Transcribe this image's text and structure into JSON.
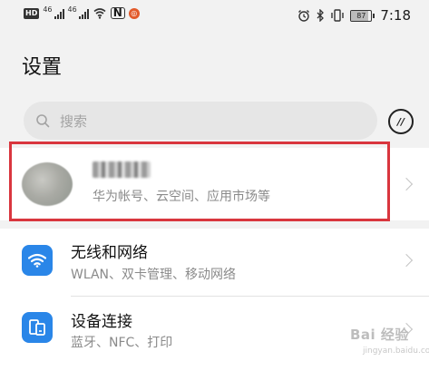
{
  "status_bar": {
    "hd_badge": "HD",
    "sig1_label": "46",
    "sig2_label": "46",
    "nfc": "N",
    "battery_level": "87",
    "battery_fraction": 0.87,
    "time": "7:18",
    "icons": [
      "hd-badge",
      "signal-icon",
      "signal-icon",
      "wifi-icon",
      "nfc-icon",
      "app-notification-icon",
      "alarm-icon",
      "bluetooth-icon",
      "vibrate-icon",
      "battery-icon"
    ]
  },
  "header": {
    "title": "设置"
  },
  "search": {
    "placeholder": "搜索",
    "icon": "search-icon"
  },
  "hi_button": {
    "label": "//"
  },
  "account": {
    "name": "",
    "subtitle": "华为帐号、云空间、应用市场等",
    "highlight_color": "#d9363e"
  },
  "settings": [
    {
      "title": "无线和网络",
      "subtitle": "WLAN、双卡管理、移动网络",
      "icon": "wifi-icon"
    },
    {
      "title": "设备连接",
      "subtitle": "蓝牙、NFC、打印",
      "icon": "device-connect-icon"
    }
  ],
  "watermark": {
    "text": "Bai 经验",
    "sub": "jingyan.baidu.com"
  },
  "colors": {
    "accent": "#2a86e8",
    "highlight": "#d9363e",
    "background": "#f2f2f2"
  }
}
